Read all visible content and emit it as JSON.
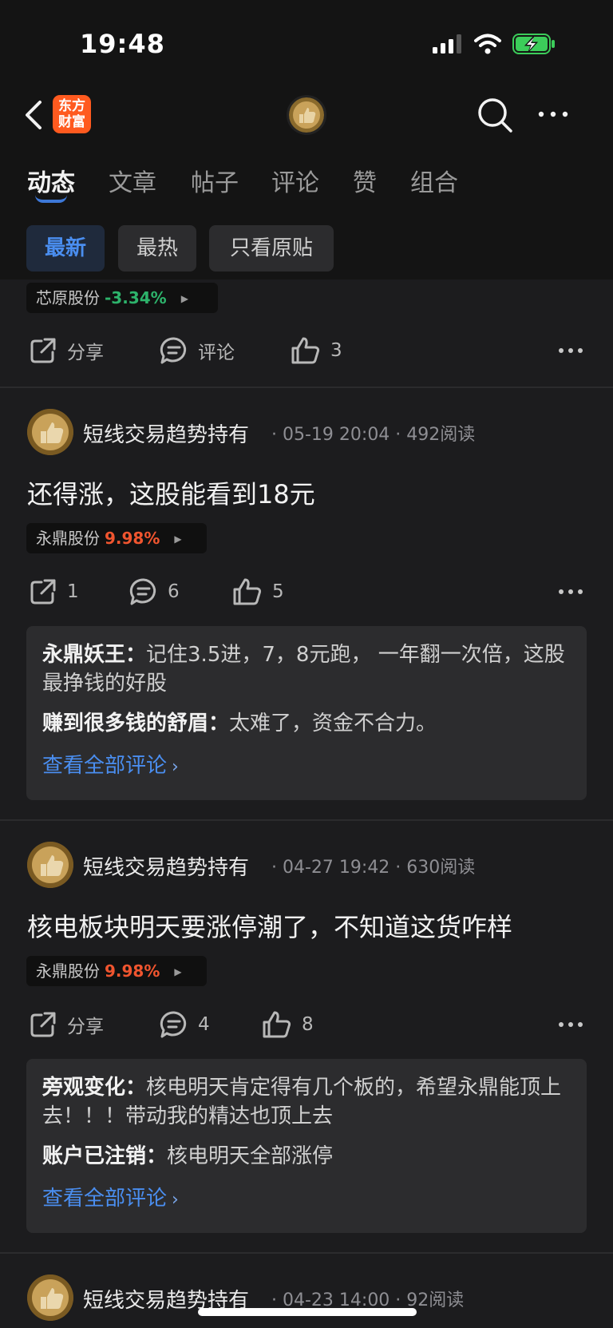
{
  "status": {
    "time": "19:48"
  },
  "header": {
    "logo_text_1": "东方",
    "logo_text_2": "财富"
  },
  "tabs": [
    "动态",
    "文章",
    "帖子",
    "评论",
    "赞",
    "组合"
  ],
  "filters": [
    "最新",
    "最热",
    "只看原贴"
  ],
  "prev_post": {
    "stock": {
      "name": "芯原股份",
      "change": "-3.34%"
    },
    "actions": {
      "share": "分享",
      "comment": "评论",
      "like": "3"
    }
  },
  "posts": [
    {
      "author": "短线交易趋势持有",
      "meta": "· 05-19 20:04 · 492阅读",
      "title": "还得涨，这股能看到18元",
      "stock": {
        "name": "永鼎股份",
        "change": "9.98%"
      },
      "actions": {
        "share": "1",
        "comment": "6",
        "like": "5"
      },
      "comments": [
        {
          "user": "永鼎妖王：",
          "text": "记住3.5进，7，8元跑， 一年翻一次倍，这股最挣钱的好股"
        },
        {
          "user": "赚到很多钱的舒眉：",
          "text": "太难了，资金不合力。"
        }
      ],
      "view_all": "查看全部评论"
    },
    {
      "author": "短线交易趋势持有",
      "meta": "· 04-27 19:42 · 630阅读",
      "title": "核电板块明天要涨停潮了，不知道这货咋样",
      "stock": {
        "name": "永鼎股份",
        "change": "9.98%"
      },
      "actions": {
        "share": "分享",
        "comment": "4",
        "like": "8"
      },
      "comments": [
        {
          "user": "旁观变化：",
          "text": "核电明天肯定得有几个板的，希望永鼎能顶上去！！！带动我的精达也顶上去"
        },
        {
          "user": "账户已注销：",
          "text": "核电明天全部涨停"
        }
      ],
      "view_all": "查看全部评论"
    },
    {
      "author": "短线交易趋势持有",
      "meta": "· 04-23 14:00 · 92阅读"
    }
  ],
  "colors": {
    "accent": "#4a8ef0",
    "up": "#f0552f",
    "down": "#2db36b",
    "brand": "#ff5a1f"
  },
  "icons": [
    "back-arrow-icon",
    "search-icon",
    "more-dots-icon",
    "share-icon",
    "comment-icon",
    "thumbs-up-icon",
    "chevron-right-icon"
  ]
}
